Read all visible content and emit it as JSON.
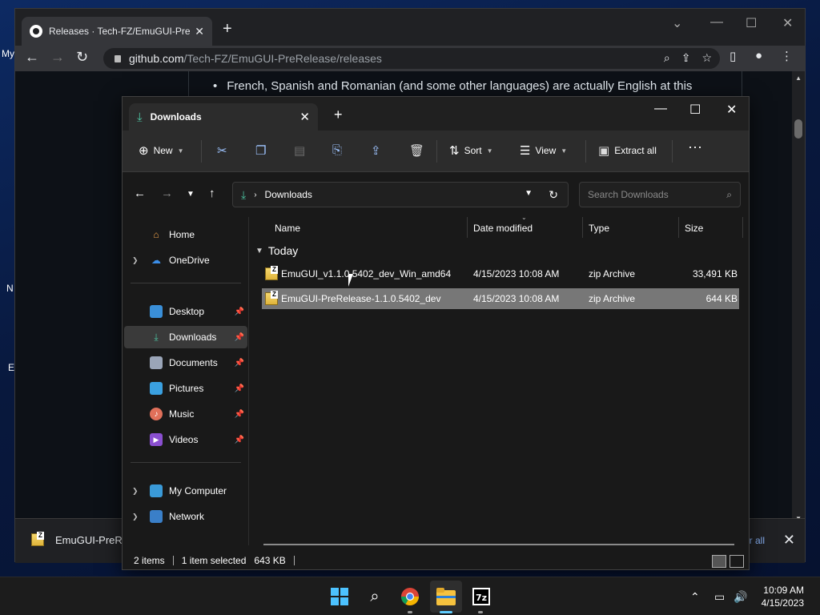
{
  "desktop": {
    "fragments": [
      "My",
      "N",
      "E"
    ]
  },
  "chrome": {
    "tab_title": "Releases · Tech-FZ/EmuGUI-PreR",
    "url_host": "github.com",
    "url_path": "/Tech-FZ/EmuGUI-PreRelease/releases",
    "page_bullet": "French, Spanish and Romanian (and some other languages) are actually English at this",
    "download_item": "EmuGUI-PreRe",
    "download_show_all": "r all"
  },
  "explorer": {
    "tab_title": "Downloads",
    "commands": {
      "new": "New",
      "sort": "Sort",
      "view": "View",
      "extract_all": "Extract all"
    },
    "address": {
      "location": "Downloads",
      "search_placeholder": "Search Downloads"
    },
    "nav": {
      "home": "Home",
      "onedrive": "OneDrive",
      "desktop": "Desktop",
      "downloads": "Downloads",
      "documents": "Documents",
      "pictures": "Pictures",
      "music": "Music",
      "videos": "Videos",
      "my_computer": "My Computer",
      "network": "Network"
    },
    "columns": {
      "name": "Name",
      "date": "Date modified",
      "type": "Type",
      "size": "Size"
    },
    "group": "Today",
    "files": [
      {
        "name": "EmuGUI_v1.1.0.5402_dev_Win_amd64",
        "date": "4/15/2023 10:08 AM",
        "type": "zip Archive",
        "size": "33,491 KB",
        "selected": false
      },
      {
        "name": "EmuGUI-PreRelease-1.1.0.5402_dev",
        "date": "4/15/2023 10:08 AM",
        "type": "zip Archive",
        "size": "644 KB",
        "selected": true
      }
    ],
    "status": {
      "items": "2 items",
      "selected": "1 item selected",
      "selected_size": "643 KB"
    }
  },
  "taskbar": {
    "time": "10:09 AM",
    "date": "4/15/2023",
    "icons": [
      "start-icon",
      "search-icon",
      "chrome-icon",
      "file-explorer-icon",
      "7zip-icon"
    ]
  },
  "colors": {
    "accent": "#60cdff",
    "selection": "#777777",
    "explorer_bg": "#191919"
  }
}
